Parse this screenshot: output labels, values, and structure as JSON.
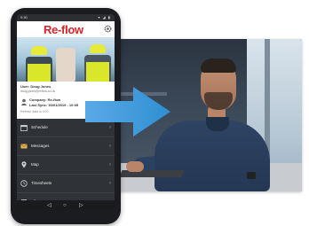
{
  "phone": {
    "status_time": "9:30",
    "status_icons": "▾ ◢ ▮",
    "app": {
      "logo": "Re-flow"
    },
    "user": {
      "name": "User: Doug Jones",
      "email": "doug.jones@reflow.co.uk",
      "company_label": "Company: Re-flow",
      "last_sync": "Last Sync: 30/01/2019 - 10:05",
      "status": "Refresh data in 4:00"
    },
    "menu": [
      {
        "label": "Schedule",
        "icon": "calendar-icon"
      },
      {
        "label": "Messages",
        "icon": "envelope-icon"
      },
      {
        "label": "Map",
        "icon": "map-pin-icon"
      },
      {
        "label": "Timesheets",
        "icon": "clock-icon"
      },
      {
        "label": "All Forms",
        "icon": "list-icon"
      }
    ],
    "nav": {
      "back": "◁",
      "home": "○",
      "recent": "▷"
    }
  },
  "colors": {
    "brand_red": "#d8232a",
    "arrow_blue": "#2f8fd3",
    "menu_bg": "#2f3236"
  }
}
